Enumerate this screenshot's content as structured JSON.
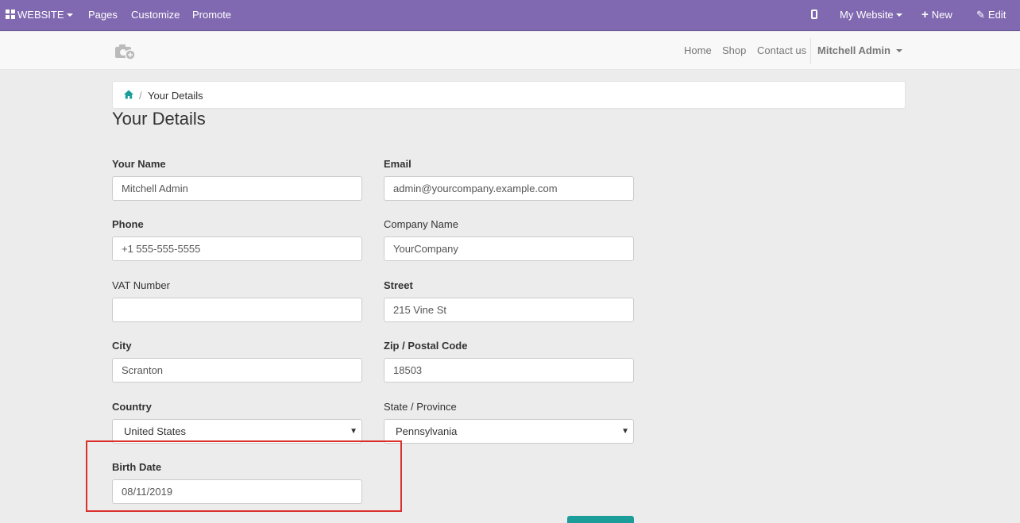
{
  "topbar": {
    "app_label": "WEBSITE",
    "menus": [
      "Pages",
      "Customize",
      "Promote"
    ],
    "site_selector": "My Website",
    "new_label": "New",
    "edit_label": "Edit"
  },
  "header": {
    "nav": [
      "Home",
      "Shop",
      "Contact us"
    ],
    "user": "Mitchell Admin"
  },
  "breadcrumb": {
    "current": "Your Details"
  },
  "page_title": "Your Details",
  "form": {
    "name": {
      "label": "Your Name",
      "value": "Mitchell Admin"
    },
    "email": {
      "label": "Email",
      "value": "admin@yourcompany.example.com"
    },
    "phone": {
      "label": "Phone",
      "value": "+1 555-555-5555"
    },
    "company": {
      "label": "Company Name",
      "value": "YourCompany"
    },
    "vat": {
      "label": "VAT Number",
      "value": ""
    },
    "street": {
      "label": "Street",
      "value": "215 Vine St"
    },
    "city": {
      "label": "City",
      "value": "Scranton"
    },
    "zip": {
      "label": "Zip / Postal Code",
      "value": "18503"
    },
    "country": {
      "label": "Country",
      "value": "United States"
    },
    "state": {
      "label": "State / Province",
      "value": "Pennsylvania"
    },
    "birth_date": {
      "label": "Birth Date",
      "value": "08/11/2019"
    }
  },
  "colors": {
    "topbar": "#8069b0",
    "accent": "#1c9d9a",
    "highlight": "#d9302c"
  }
}
